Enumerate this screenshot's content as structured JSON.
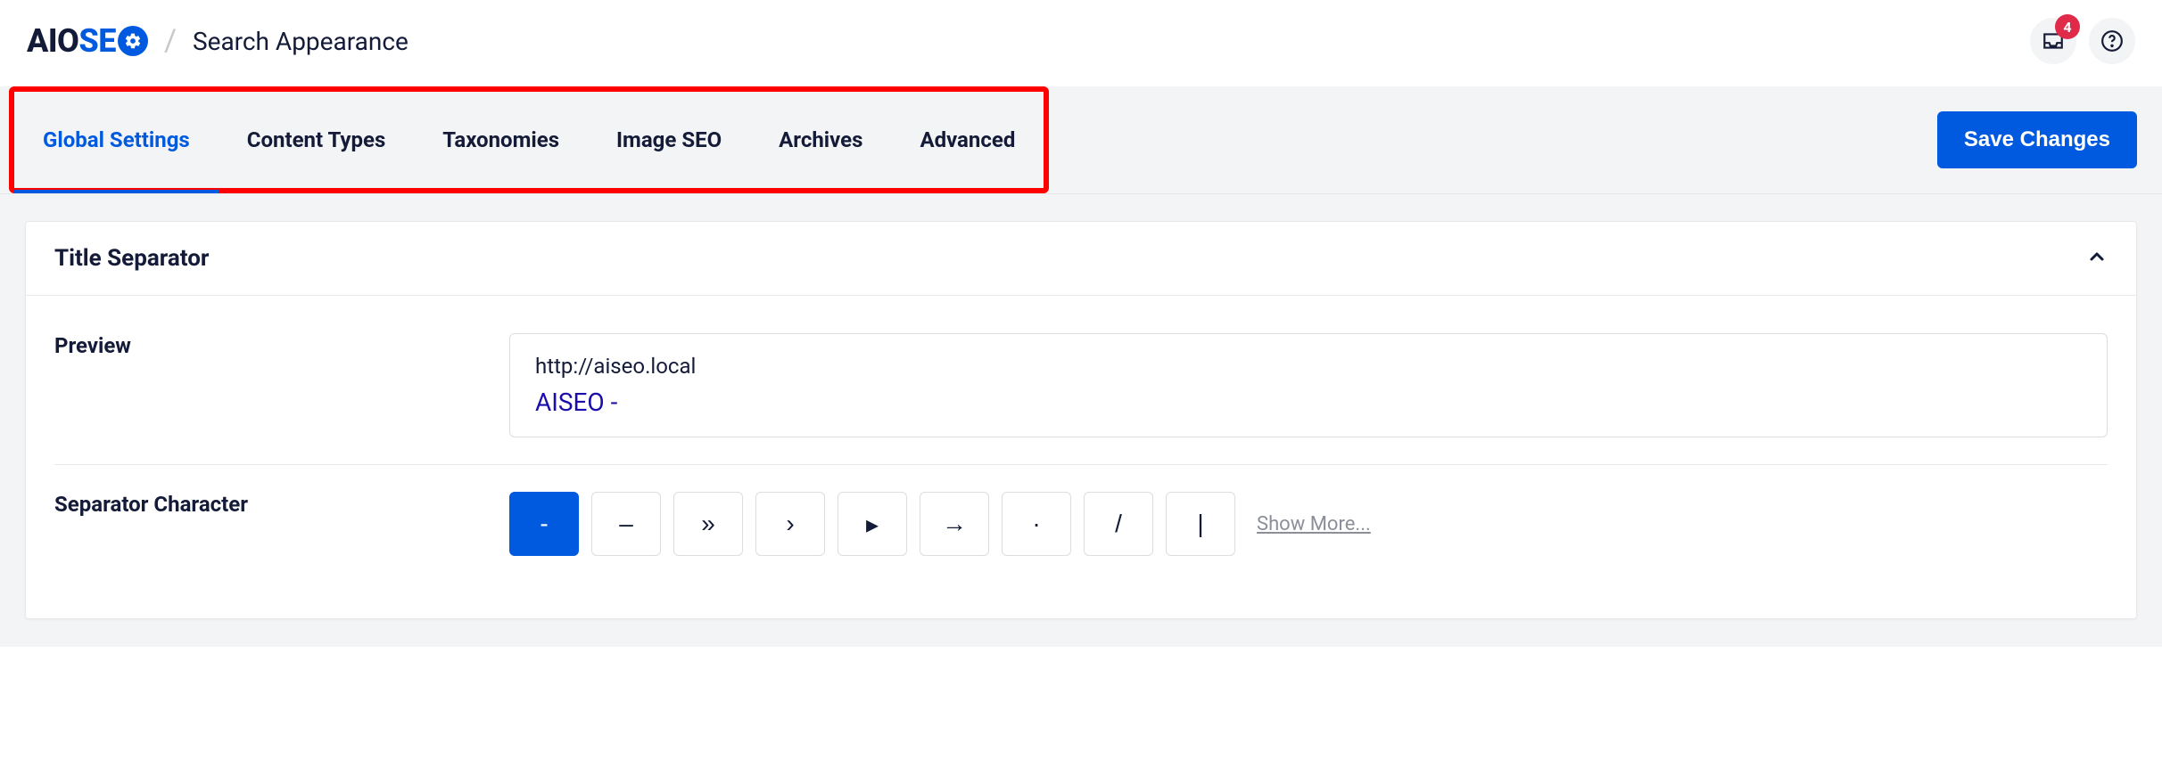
{
  "header": {
    "logo_aio": "AIO",
    "logo_se": "SE",
    "page_title": "Search Appearance",
    "notification_count": "4"
  },
  "tabs": {
    "items": [
      "Global Settings",
      "Content Types",
      "Taxonomies",
      "Image SEO",
      "Archives",
      "Advanced"
    ],
    "active_index": 0,
    "save_label": "Save Changes"
  },
  "card": {
    "title": "Title Separator",
    "preview_label": "Preview",
    "preview_url": "http://aiseo.local",
    "preview_title": "AISEO -",
    "separator_label": "Separator Character",
    "separators": [
      "-",
      "–",
      "»",
      "›",
      "▸",
      "→",
      "·",
      "/",
      "|"
    ],
    "separator_active_index": 0,
    "show_more": "Show More..."
  }
}
